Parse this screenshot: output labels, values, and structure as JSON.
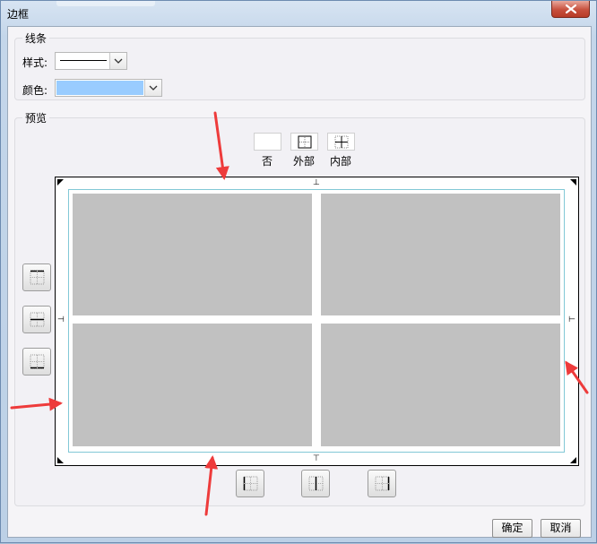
{
  "window": {
    "title": "边框"
  },
  "lines": {
    "group_label": "线条",
    "style_label": "样式:",
    "color_label": "颜色:",
    "color_value": "#99ccff"
  },
  "preview": {
    "group_label": "预览",
    "presets": [
      {
        "label": "否"
      },
      {
        "label": "外部"
      },
      {
        "label": "内部"
      }
    ],
    "marker_top": "⊥",
    "marker_bottom": "⊤",
    "marker_left": "⊣",
    "marker_right": "⊢"
  },
  "buttons": {
    "ok": "确定",
    "cancel": "取消"
  },
  "colors": {
    "cell_fill": "#c1c1c1",
    "inner_border": "#82c8d6",
    "annotation_arrow": "#ee3b3b"
  }
}
